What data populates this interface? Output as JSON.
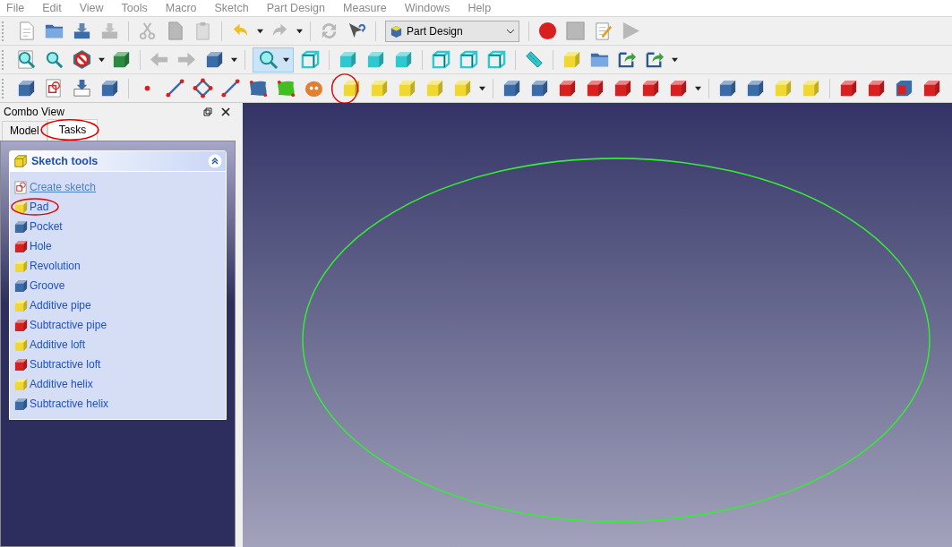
{
  "menu": [
    {
      "label": "File",
      "disabled": true
    },
    {
      "label": "Edit",
      "disabled": true
    },
    {
      "label": "View",
      "disabled": true
    },
    {
      "label": "Tools",
      "disabled": true
    },
    {
      "label": "Macro",
      "disabled": true
    },
    {
      "label": "Sketch",
      "disabled": true
    },
    {
      "label": "Part Design",
      "disabled": true
    },
    {
      "label": "Measure",
      "disabled": true
    },
    {
      "label": "Windows",
      "disabled": true
    },
    {
      "label": "Help",
      "disabled": true
    }
  ],
  "workbench": {
    "value": "Part Design"
  },
  "combo_view": {
    "title": "Combo View",
    "tabs": [
      {
        "label": "Model",
        "selected": false
      },
      {
        "label": "Tasks",
        "selected": true
      }
    ]
  },
  "task_panel": {
    "title": "Sketch tools",
    "expanded": true,
    "items": [
      {
        "label": "Create sketch",
        "kind": "link"
      },
      {
        "label": "Pad",
        "kind": "command"
      },
      {
        "label": "Pocket",
        "kind": "command"
      },
      {
        "label": "Hole",
        "kind": "command"
      },
      {
        "label": "Revolution",
        "kind": "command"
      },
      {
        "label": "Groove",
        "kind": "command"
      },
      {
        "label": "Additive pipe",
        "kind": "command"
      },
      {
        "label": "Subtractive pipe",
        "kind": "command"
      },
      {
        "label": "Additive loft",
        "kind": "command"
      },
      {
        "label": "Subtractive loft",
        "kind": "command"
      },
      {
        "label": "Additive helix",
        "kind": "command"
      },
      {
        "label": "Subtractive helix",
        "kind": "command"
      }
    ]
  }
}
